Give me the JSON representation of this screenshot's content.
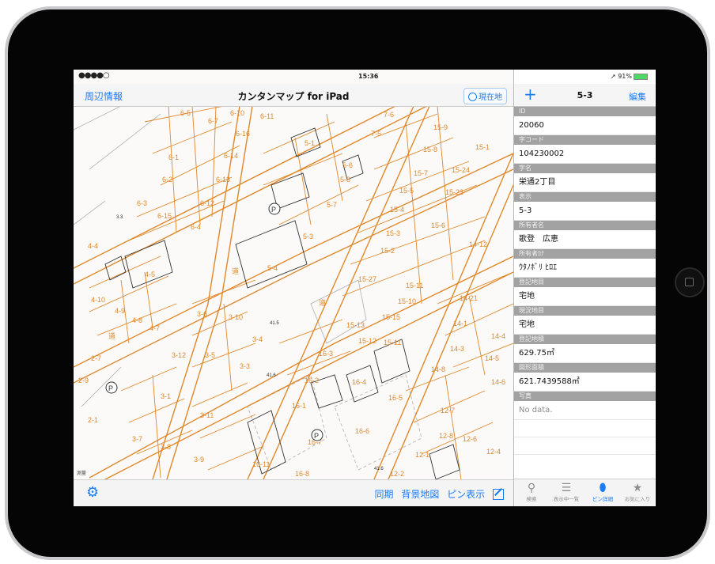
{
  "status_bar": {
    "signal": "●●●●○",
    "time": "15:36",
    "battery": "➚ 91%"
  },
  "map_nav": {
    "left_button": "周辺情報",
    "title": "カンタンマップ for iPad",
    "location_button": "現在地"
  },
  "map": {
    "parcel_labels": [
      "6-5",
      "6-7",
      "6-10",
      "6-11",
      "6-16",
      "6-1",
      "6-14",
      "6-2",
      "6-13",
      "6-12",
      "6-3",
      "6-15",
      "6-4",
      "5-1",
      "5-6",
      "5-8",
      "5-7",
      "5-4",
      "5-3",
      "7-6",
      "7-5",
      "15-9",
      "15-1",
      "15-8",
      "15-7",
      "15-24",
      "15-5",
      "15-23",
      "15-4",
      "15-6",
      "15-3",
      "15-2",
      "15-27",
      "15-11",
      "15-10",
      "15-15",
      "15-13",
      "15-12",
      "15-11",
      "14-1",
      "14-12",
      "14-21",
      "14-3",
      "14-4",
      "14-5",
      "14-6",
      "14-8",
      "4-4",
      "4-5",
      "4-10",
      "4-9",
      "4-8",
      "4-7",
      "3-6",
      "3-10",
      "3-4",
      "3-5",
      "3-3",
      "3-12",
      "3-11",
      "3-7",
      "3-8",
      "3-9",
      "3-1",
      "2-7",
      "2-9",
      "2-1",
      "16-3",
      "16-2",
      "16-4",
      "16-5",
      "16-1",
      "16-7",
      "16-6",
      "16-11",
      "16-8",
      "12-7",
      "12-8",
      "12-6",
      "12-4",
      "12-1",
      "12-2",
      "道",
      "道",
      "道"
    ],
    "parking_marker": "P",
    "scale_label": "測量",
    "small_numbers": [
      "41.5",
      "3.3",
      "41.6",
      "41.6"
    ]
  },
  "map_toolbar": {
    "settings": "settings",
    "sync": "同期",
    "background_map": "背景地図",
    "pin_display": "ピン表示"
  },
  "detail_nav": {
    "add": "+",
    "title": "5-3",
    "edit": "編集"
  },
  "detail_fields": [
    {
      "label": "ID",
      "value": "20060"
    },
    {
      "label": "字コード",
      "value": "104230002"
    },
    {
      "label": "字名",
      "value": "栄通2丁目"
    },
    {
      "label": "表示",
      "value": "5-3"
    },
    {
      "label": "所有者名",
      "value": "歌登　広恵"
    },
    {
      "label": "所有者ｶﾅ",
      "value": "ｳﾀﾉﾎﾞﾘ ﾋﾛｴ"
    },
    {
      "label": "登記地目",
      "value": "宅地"
    },
    {
      "label": "現況地目",
      "value": "宅地"
    },
    {
      "label": "登記地積",
      "value": "629.75㎡"
    },
    {
      "label": "図形面積",
      "value": "621.7439588㎡"
    },
    {
      "label": "写真",
      "value": "No data."
    }
  ],
  "tabs": [
    {
      "label": "検索",
      "icon": "search-icon",
      "glyph": "⚲"
    },
    {
      "label": "表示中一覧",
      "icon": "list-icon",
      "glyph": "☰"
    },
    {
      "label": "ピン詳細",
      "icon": "pin-icon",
      "glyph": "⬮"
    },
    {
      "label": "お気に入り",
      "icon": "star-icon",
      "glyph": "★"
    }
  ],
  "colors": {
    "accent": "#1a7cf5",
    "parcel_line": "#e0882a",
    "field_label_bg": "#a2a2a2"
  }
}
